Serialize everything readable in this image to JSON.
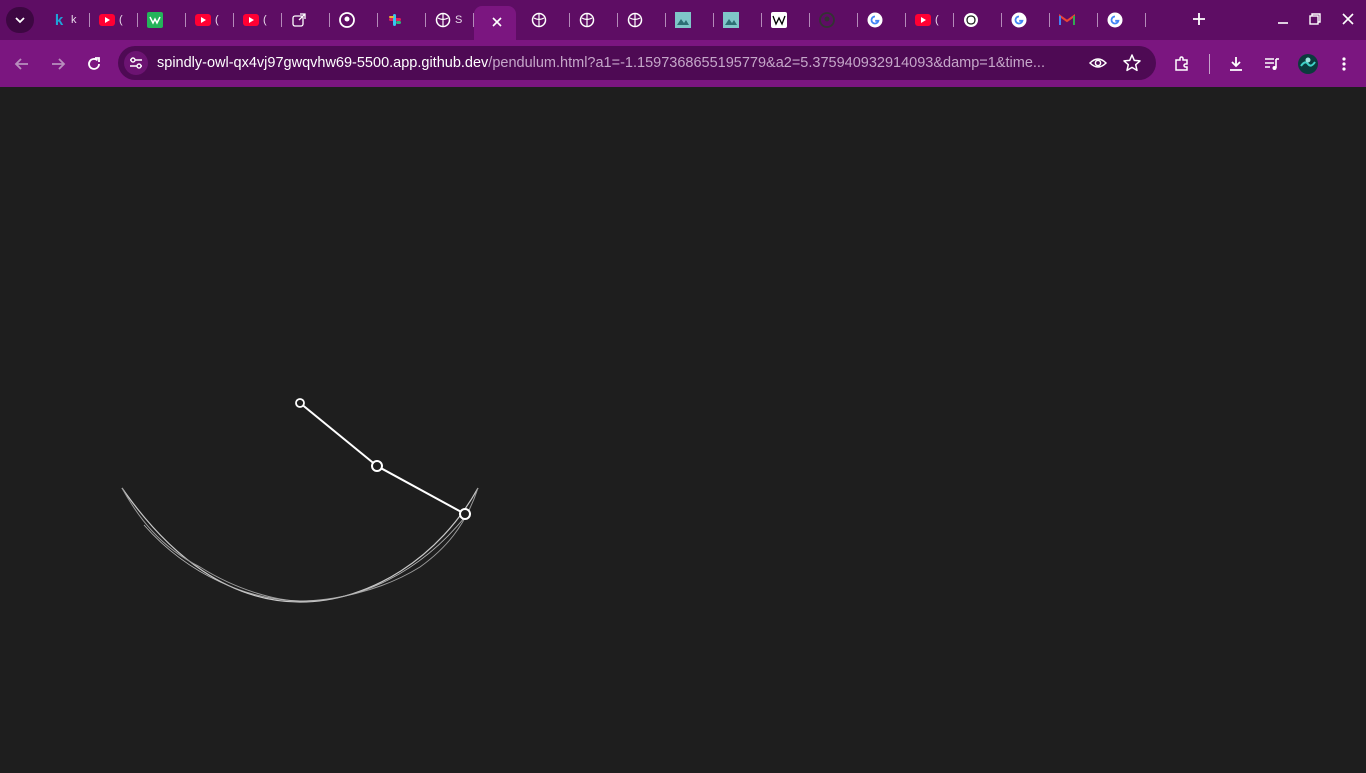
{
  "browser": {
    "url_host": "spindly-owl-qx4vj97gwqvhw69-5500.app.github.dev",
    "url_path": "/pendulum.html?a1=-1.1597368655195779&a2=5.375940932914093&damp=1&time...",
    "tabs": [
      {
        "favicon": "k-icon",
        "title": "k",
        "color": "#1fa3d9"
      },
      {
        "favicon": "youtube-icon",
        "title": "(",
        "color": "#ff0033"
      },
      {
        "favicon": "grade-icon",
        "title": "",
        "color": "#24b35a"
      },
      {
        "favicon": "youtube-icon",
        "title": "(",
        "color": "#ff0033"
      },
      {
        "favicon": "youtube-icon",
        "title": "(",
        "color": "#ff0033"
      },
      {
        "favicon": "external-icon",
        "title": "",
        "color": "#ffffff"
      },
      {
        "favicon": "github-icon",
        "title": "",
        "color": "#ffffff"
      },
      {
        "favicon": "slack-icon",
        "title": "",
        "color": "#e01e5a"
      },
      {
        "favicon": "globe-icon",
        "title": "S",
        "color": "#ffffff"
      },
      {
        "favicon": "globe-icon",
        "title": "",
        "color": "#ffffff"
      },
      {
        "favicon": "globe-icon",
        "title": "",
        "color": "#ffffff"
      },
      {
        "favicon": "globe-icon",
        "title": "",
        "color": "#ffffff"
      },
      {
        "favicon": "globe-icon",
        "title": "",
        "color": "#ffffff"
      },
      {
        "favicon": "image-icon",
        "title": "",
        "color": "#7fc6c9"
      },
      {
        "favicon": "image-icon",
        "title": "",
        "color": "#7fc6c9"
      },
      {
        "favicon": "wikipedia-icon",
        "title": "",
        "color": "#ffffff"
      },
      {
        "favicon": "github-icon",
        "title": "",
        "color": "#333333"
      },
      {
        "favicon": "google-icon",
        "title": "",
        "color": "#4285f4"
      },
      {
        "favicon": "youtube-icon",
        "title": "(",
        "color": "#ff0033"
      },
      {
        "favicon": "chatgpt-icon",
        "title": "",
        "color": "#ffffff"
      },
      {
        "favicon": "google-icon",
        "title": "",
        "color": "#4285f4"
      },
      {
        "favicon": "gmail-icon",
        "title": "",
        "color": "#ea4335"
      },
      {
        "favicon": "google-icon",
        "title": "",
        "color": "#4285f4"
      }
    ],
    "active_tab_index": 9
  },
  "colors": {
    "tabstrip": "#5e0d64",
    "toolbar": "#7b1680",
    "canvas_bg": "#1e1e1e",
    "pendulum": "#ffffff"
  },
  "pendulum": {
    "a1": -1.1597368655195779,
    "a2": 5.375940932914093,
    "damp": 1
  }
}
